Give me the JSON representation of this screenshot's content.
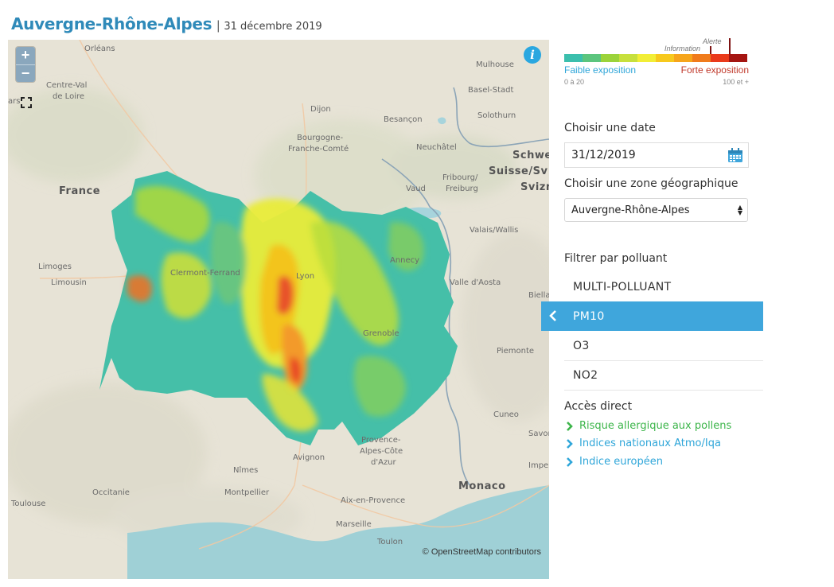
{
  "header": {
    "title": "Auvergne-Rhône-Alpes",
    "separator": "|",
    "date": "31 décembre 2019"
  },
  "map": {
    "zoom_in": "+",
    "zoom_out": "−",
    "info": "i",
    "attribution": "© OpenStreetMap contributors",
    "labels": {
      "orleans": "Orléans",
      "centre_val": "Centre-Val",
      "de_loire": "de Loire",
      "dijon": "Dijon",
      "besancon": "Besançon",
      "bourgogne": "Bourgogne-",
      "franche_comte": "Franche-Comté",
      "mulhouse": "Mulhouse",
      "basel_stadt": "Basel-Stadt",
      "solothurn": "Solothurn",
      "neuchatel": "Neuchâtel",
      "schweiz": "Schwe",
      "suisse": "Suisse/Sv",
      "svizzera": "Svizn",
      "fribourg": "Fribourg/",
      "freiburg": "Freiburg",
      "vaud": "Vaud",
      "valais": "Valais/Wallis",
      "france": "France",
      "limoges": "Limoges",
      "limousin": "Limousin",
      "clermont": "Clermont-Ferrand",
      "lyon": "Lyon",
      "annecy": "Annecy",
      "valle_aosta": "Valle d'Aosta",
      "biella": "Biella",
      "grenoble": "Grenoble",
      "piemonte": "Piemonte",
      "cuneo": "Cuneo",
      "savona": "Savon",
      "imperia": "Imper",
      "provence": "Provence-",
      "alpes_cote": "Alpes-Côte",
      "d_azur": "d'Azur",
      "avignon": "Avignon",
      "nimes": "Nîmes",
      "monaco": "Monaco",
      "montpellier": "Montpellier",
      "occitanie": "Occitanie",
      "toulouse": "Toulouse",
      "aix": "Aix-en-Provence",
      "marseille": "Marseille",
      "toulon": "Toulon",
      "ars": "ars"
    }
  },
  "legend": {
    "colors": [
      "#3bbfad",
      "#5cc57e",
      "#9bd33a",
      "#c7e03c",
      "#f2ee36",
      "#f7c91d",
      "#f6a51b",
      "#f07b1c",
      "#ea3a1b",
      "#a51511"
    ],
    "information": "Information",
    "alerte": "Alerte",
    "low_label": "Faible exposition",
    "high_label": "Forte exposition",
    "low_range": "0 à 20",
    "high_range": "100 et +"
  },
  "panel": {
    "date_heading": "Choisir une date",
    "date_value": "31/12/2019",
    "zone_heading": "Choisir une zone géographique",
    "zone_value": "Auvergne-Rhône-Alpes",
    "pollutant_heading": "Filtrer par polluant",
    "pollutants": [
      "MULTI-POLLUANT",
      "PM10",
      "O3",
      "NO2"
    ],
    "active_pollutant": "PM10",
    "access_heading": "Accès direct",
    "links": [
      {
        "label": "Risque allergique aux pollens",
        "color": "#3cb54a"
      },
      {
        "label": "Indices nationaux Atmo/Iqa",
        "color": "#2fa6d9"
      },
      {
        "label": "Indice européen",
        "color": "#2fa6d9"
      }
    ]
  }
}
